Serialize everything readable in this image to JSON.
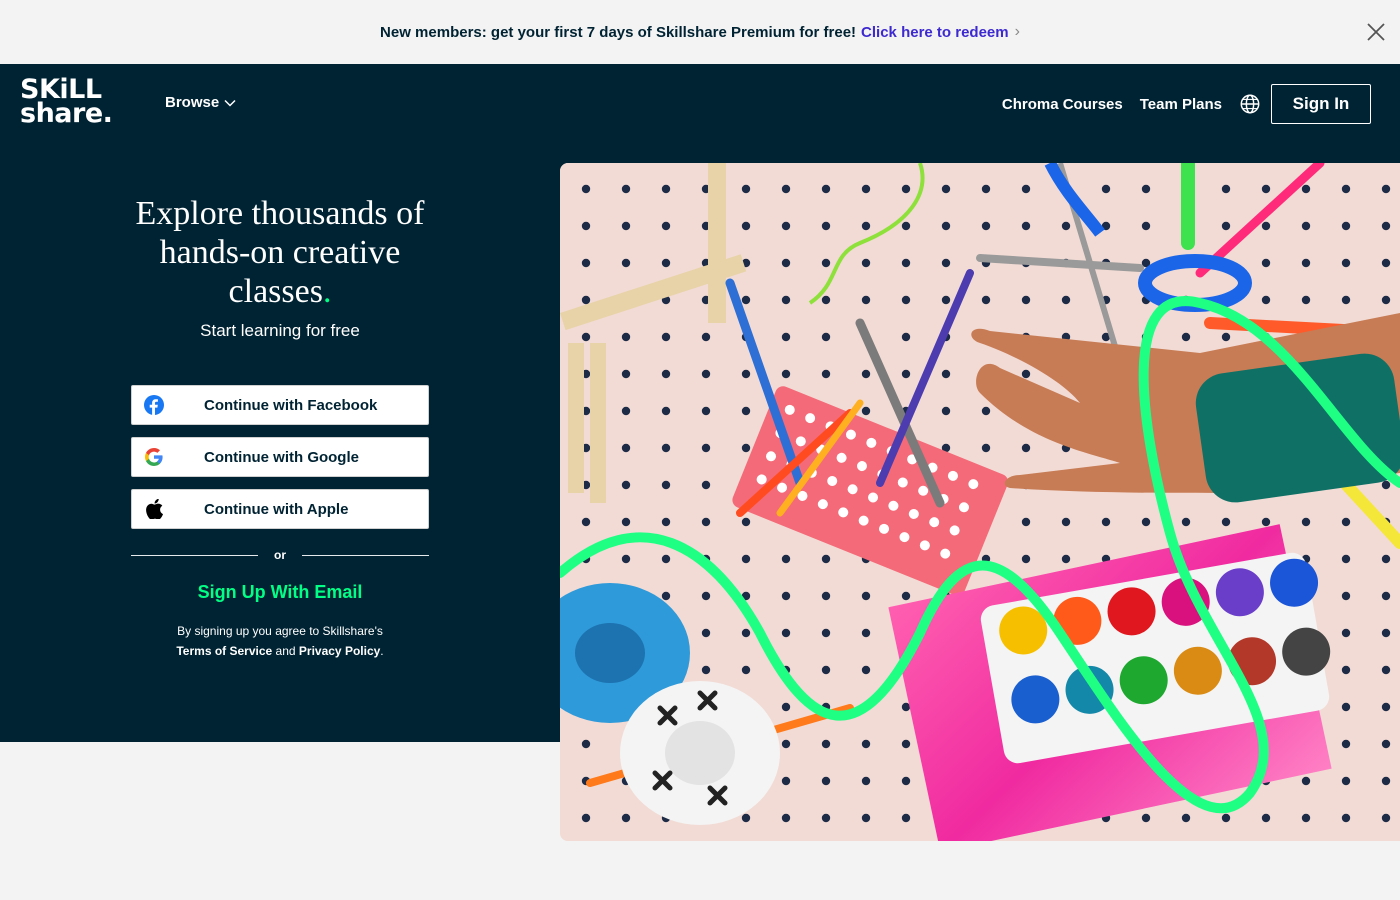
{
  "promo": {
    "text": "New members: get your first 7 days of Skillshare Premium for free!",
    "link": "Click here to redeem",
    "close_icon": "close-icon"
  },
  "header": {
    "logo_line1": "SKiLL",
    "logo_line2": "share.",
    "browse": "Browse",
    "links": [
      "Chroma Courses",
      "Team Plans"
    ],
    "language_icon": "globe-icon",
    "signin": "Sign In"
  },
  "hero": {
    "title_line1": "Explore thousands of",
    "title_line2": "hands-on creative",
    "title_line3": "classes",
    "title_dot": ".",
    "subtitle": "Start learning for free",
    "facebook": "Continue with Facebook",
    "google": "Continue with Google",
    "apple": "Continue with Apple",
    "or": "or",
    "signup_email": "Sign Up With Email",
    "legal_prefix": "By signing up you agree to Skillshare's",
    "terms": "Terms of Service",
    "and": "and",
    "privacy": "Privacy Policy",
    "period": "."
  },
  "colors": {
    "navy": "#002333",
    "accent_green": "#00ff84",
    "link_purple": "#3d29d0",
    "facebook_blue": "#1877f2"
  }
}
